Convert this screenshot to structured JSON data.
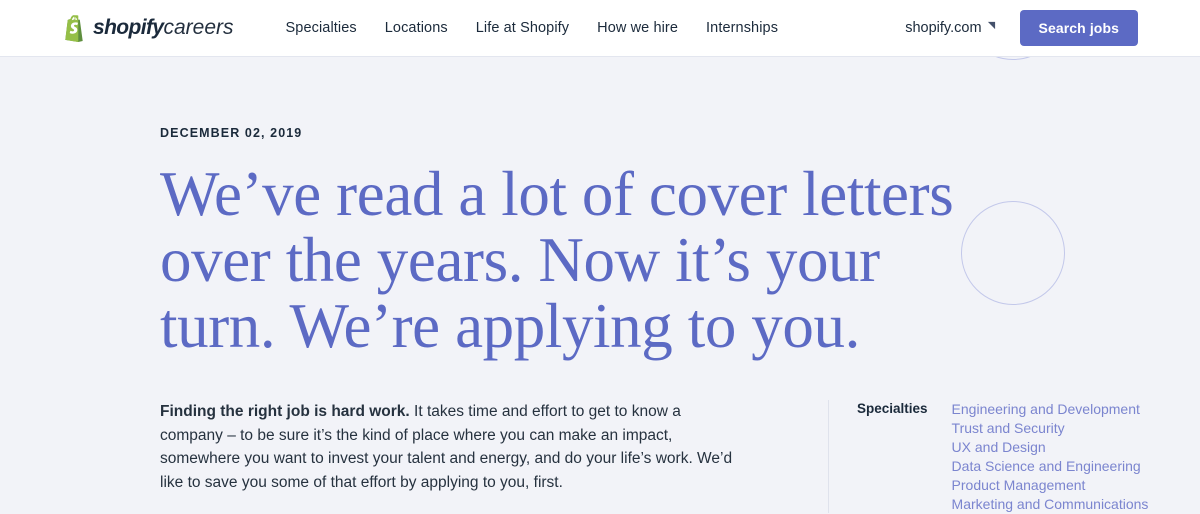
{
  "header": {
    "brand": {
      "name_bold": "shopify",
      "name_light": "careers",
      "logo_icon": "shopify-bag-icon",
      "logo_color": "#95bf47"
    },
    "nav": [
      {
        "label": "Specialties"
      },
      {
        "label": "Locations"
      },
      {
        "label": "Life at Shopify"
      },
      {
        "label": "How we hire"
      },
      {
        "label": "Internships"
      }
    ],
    "external_link": {
      "label": "shopify.com",
      "icon": "external-link-arrow-icon"
    },
    "search_jobs_label": "Search jobs",
    "accent_color": "#5c6ac4"
  },
  "article": {
    "date": "DECEMBER 02, 2019",
    "title": "We’ve read a lot of cover letters over the years. Now it’s your turn. We’re applying to you.",
    "title_color": "#5c6ac4",
    "body_lead": "Finding the right job is hard work.",
    "body_rest": " It takes time and effort to get to know a company – to be sure it’s the kind of place where you can make an impact, somewhere you want to invest your talent and energy, and do your life’s work. We’d like to save you some of that effort by applying to you, first."
  },
  "specialties": {
    "label": "Specialties",
    "items": [
      {
        "label": "Engineering and Development"
      },
      {
        "label": "Trust and Security"
      },
      {
        "label": "UX and Design"
      },
      {
        "label": "Data Science and Engineering"
      },
      {
        "label": "Product Management"
      },
      {
        "label": "Marketing and Communications"
      }
    ],
    "link_color": "#7b85cf"
  },
  "decor": {
    "circle_stroke": "#c3c8ea",
    "page_background": "#f2f3f8"
  }
}
